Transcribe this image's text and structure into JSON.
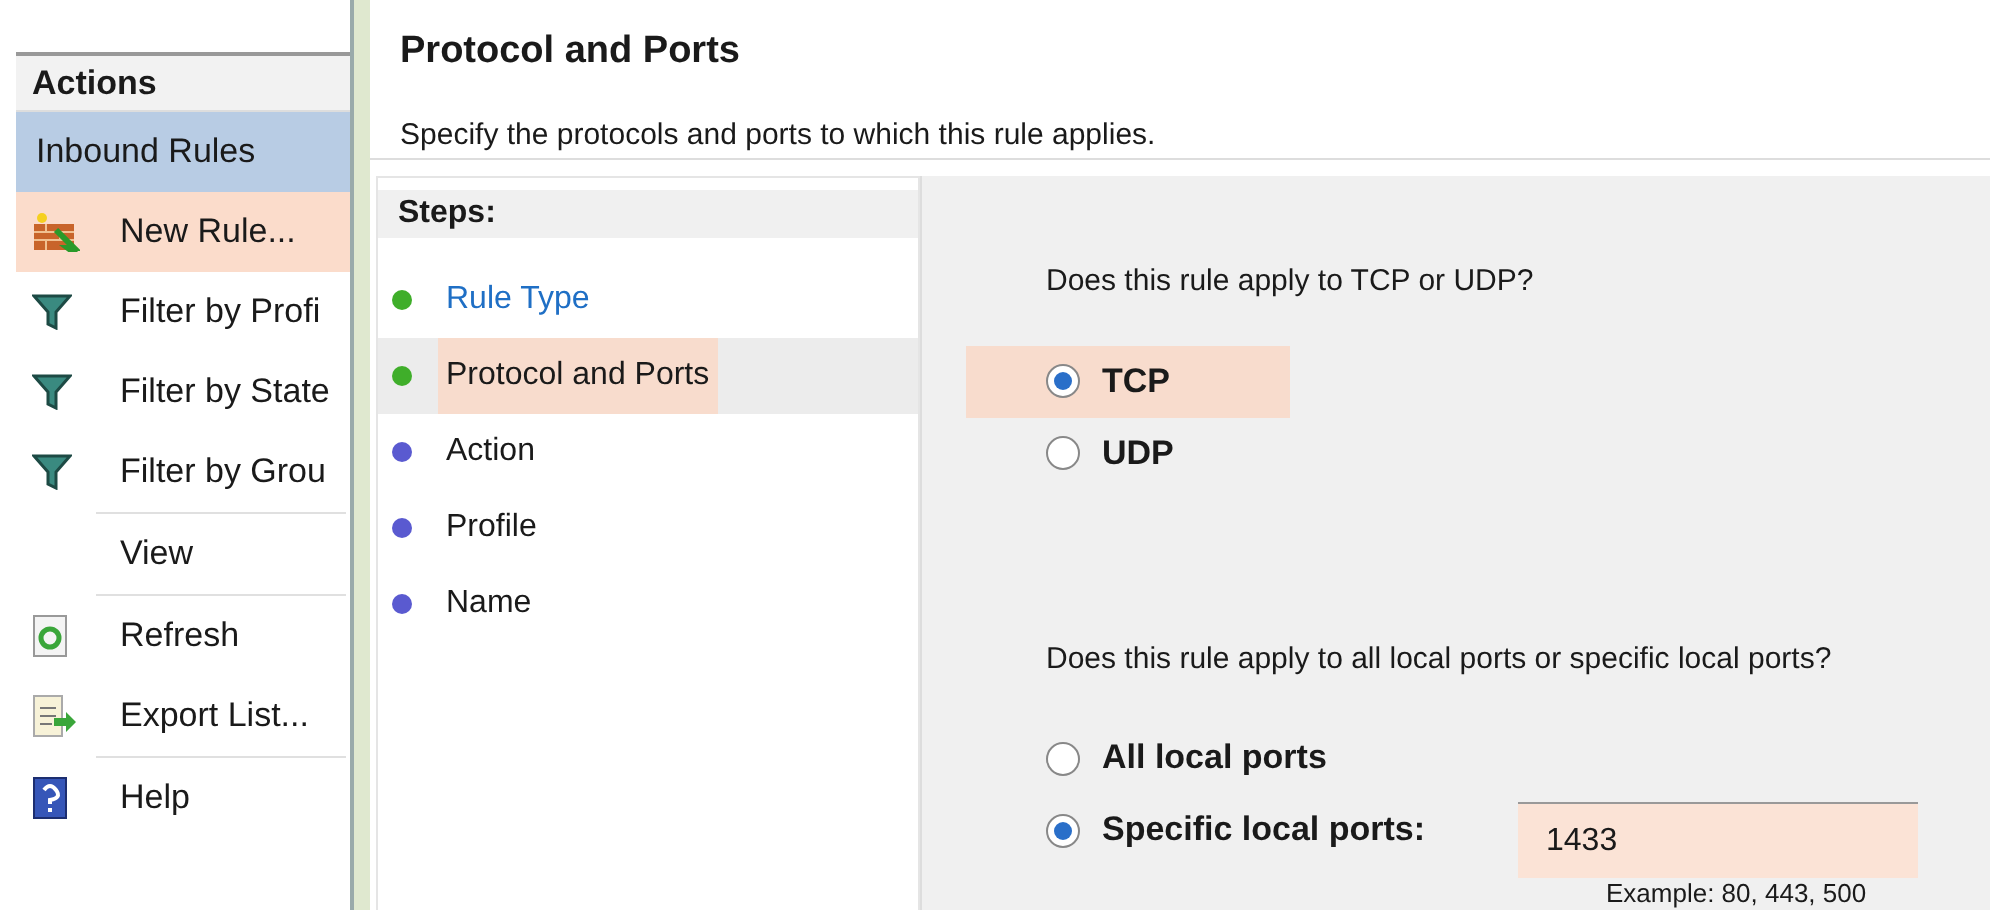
{
  "actions": {
    "title": "Actions",
    "section": {
      "label": "Inbound Rules",
      "selected": true
    },
    "items": [
      {
        "label": "New Rule...",
        "kind": "new-rule",
        "highlighted": true,
        "separator_before": false
      },
      {
        "label": "Filter by Profi",
        "kind": "filter",
        "highlighted": false,
        "separator_before": false
      },
      {
        "label": "Filter by State",
        "kind": "filter",
        "highlighted": false,
        "separator_before": false
      },
      {
        "label": "Filter by Grou",
        "kind": "filter",
        "highlighted": false,
        "separator_before": false
      },
      {
        "label": "View",
        "kind": "none",
        "highlighted": false,
        "separator_before": true
      },
      {
        "label": "Refresh",
        "kind": "refresh",
        "highlighted": false,
        "separator_before": true
      },
      {
        "label": "Export List...",
        "kind": "export",
        "highlighted": false,
        "separator_before": false
      },
      {
        "label": "Help",
        "kind": "help",
        "highlighted": false,
        "separator_before": true
      }
    ]
  },
  "wizard": {
    "title": "Protocol and Ports",
    "subtitle": "Specify the protocols and ports to which this rule applies.",
    "steps_title": "Steps:",
    "steps": [
      {
        "label": "Rule Type",
        "color": "#3fae2a",
        "selected": false,
        "link": true,
        "highlighted": false
      },
      {
        "label": "Protocol and Ports",
        "color": "#3fae2a",
        "selected": true,
        "link": false,
        "highlighted": true
      },
      {
        "label": "Action",
        "color": "#5a5ad0",
        "selected": false,
        "link": false,
        "highlighted": false
      },
      {
        "label": "Profile",
        "color": "#5a5ad0",
        "selected": false,
        "link": false,
        "highlighted": false
      },
      {
        "label": "Name",
        "color": "#5a5ad0",
        "selected": false,
        "link": false,
        "highlighted": false
      }
    ],
    "protocol_question": "Does this rule apply to TCP or UDP?",
    "protocols": [
      {
        "label": "TCP",
        "selected": true,
        "highlighted": true
      },
      {
        "label": "UDP",
        "selected": false,
        "highlighted": false
      }
    ],
    "ports_question": "Does this rule apply to all local ports or specific local ports?",
    "ports": [
      {
        "label": "All local ports",
        "selected": false
      },
      {
        "label": "Specific local ports:",
        "selected": true
      }
    ],
    "ports_field": {
      "value": "1433",
      "highlighted": true
    },
    "ports_example": "Example: 80, 443, 500"
  }
}
